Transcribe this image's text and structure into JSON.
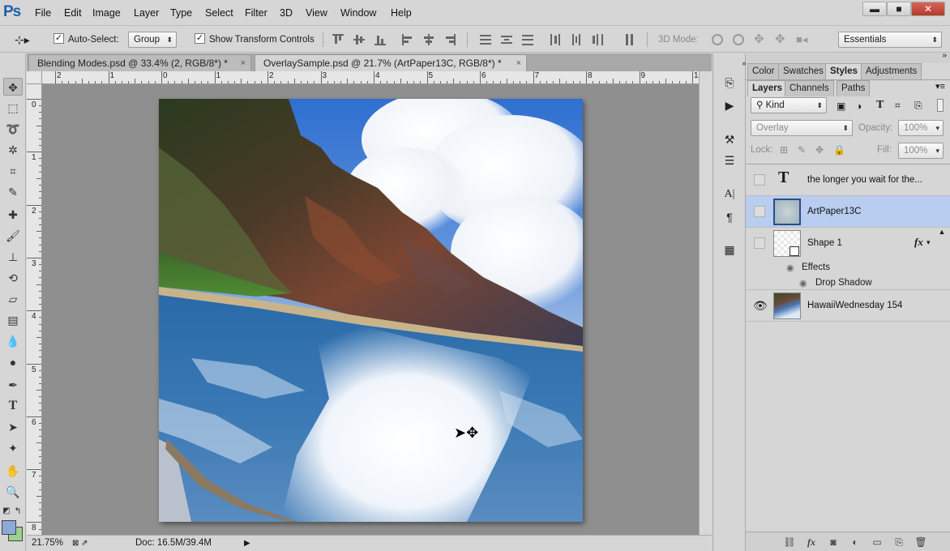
{
  "app": {
    "logo": "Ps"
  },
  "menu": [
    "File",
    "Edit",
    "Image",
    "Layer",
    "Type",
    "Select",
    "Filter",
    "3D",
    "View",
    "Window",
    "Help"
  ],
  "window_controls": {
    "minimize": "▬",
    "maximize": "■",
    "close": "✕"
  },
  "options_bar": {
    "auto_select_label": "Auto-Select:",
    "auto_select_checked": "✓",
    "auto_select_target": "Group",
    "transform_checked": "✓",
    "transform_label": "Show Transform Controls",
    "mode_3d_label": "3D Mode:",
    "workspace": "Essentials"
  },
  "documents": {
    "tabs": [
      {
        "label": "Blending Modes.psd @ 33.4% (2, RGB/8*) *",
        "close": "×",
        "active": false
      },
      {
        "label": "OverlaySample.psd @ 21.7% (ArtPaper13C, RGB/8*) *",
        "close": "×",
        "active": true
      }
    ]
  },
  "rulers": {
    "top": [
      "2",
      "1",
      "0",
      "1",
      "2",
      "3",
      "4",
      "5",
      "6",
      "7",
      "8",
      "9",
      "1"
    ],
    "left": [
      "0",
      "1",
      "2",
      "3",
      "4",
      "5",
      "6",
      "7",
      "8"
    ]
  },
  "status": {
    "zoom": "21.75%",
    "doc": "Doc: 16.5M/39.4M"
  },
  "panels": {
    "top_tabs": [
      "Color",
      "Swatches",
      "Styles",
      "Adjustments"
    ],
    "layer_tabs": [
      "Layers",
      "Channels",
      "Paths"
    ],
    "filter_kind": "Kind",
    "blend_mode": "Overlay",
    "opacity_label": "Opacity:",
    "opacity_value": "100%",
    "lock_label": "Lock:",
    "fill_label": "Fill:",
    "fill_value": "100%",
    "layers": [
      {
        "name": "the longer you wait for the...",
        "type": "text",
        "visible": false,
        "selected": false
      },
      {
        "name": "ArtPaper13C",
        "type": "image",
        "visible": false,
        "selected": true
      },
      {
        "name": "Shape 1",
        "type": "shape",
        "visible": false,
        "selected": false,
        "fx": "fx"
      },
      {
        "name": "HawaiiWednesday 154",
        "type": "image",
        "visible": true,
        "selected": false
      }
    ],
    "effects_label": "Effects",
    "drop_shadow_label": "Drop Shadow"
  },
  "colors": {
    "foreground": "#8da8d9",
    "background": "#9ed18f",
    "selection": "#b8cdf0"
  }
}
